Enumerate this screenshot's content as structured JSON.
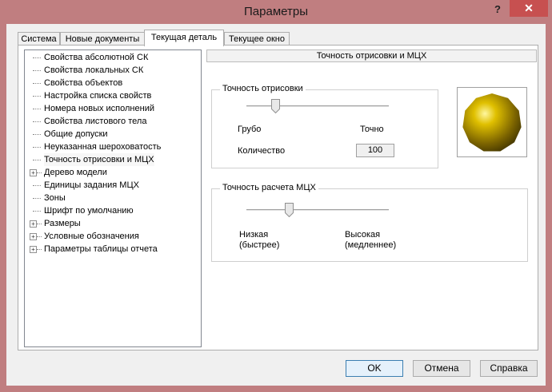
{
  "window": {
    "title": "Параметры",
    "help_label": "?",
    "close_label": "✕",
    "close_color": "#c75050"
  },
  "tabs": [
    {
      "label": "Система",
      "active": false
    },
    {
      "label": "Новые документы",
      "active": false
    },
    {
      "label": "Текущая деталь",
      "active": true
    },
    {
      "label": "Текущее окно",
      "active": false
    }
  ],
  "tree": {
    "items": [
      {
        "label": "Свойства абсолютной СК",
        "expandable": false,
        "selected": false
      },
      {
        "label": "Свойства локальных СК",
        "expandable": false,
        "selected": false
      },
      {
        "label": "Свойства объектов",
        "expandable": false,
        "selected": false
      },
      {
        "label": "Настройка списка свойств",
        "expandable": false,
        "selected": false
      },
      {
        "label": "Номера новых исполнений",
        "expandable": false,
        "selected": false
      },
      {
        "label": "Свойства листового тела",
        "expandable": false,
        "selected": false
      },
      {
        "label": "Общие допуски",
        "expandable": false,
        "selected": false
      },
      {
        "label": "Неуказанная шероховатость",
        "expandable": false,
        "selected": false
      },
      {
        "label": "Точность отрисовки и МЦХ",
        "expandable": false,
        "selected": true
      },
      {
        "label": "Дерево модели",
        "expandable": true,
        "selected": false
      },
      {
        "label": "Единицы задания МЦХ",
        "expandable": false,
        "selected": false
      },
      {
        "label": "Зоны",
        "expandable": false,
        "selected": false
      },
      {
        "label": "Шрифт по умолчанию",
        "expandable": false,
        "selected": false
      },
      {
        "label": "Размеры",
        "expandable": true,
        "selected": false
      },
      {
        "label": "Условные обозначения",
        "expandable": true,
        "selected": false
      },
      {
        "label": "Параметры таблицы отчета",
        "expandable": true,
        "selected": false
      }
    ],
    "expander_label": "+"
  },
  "pane": {
    "header": "Точность отрисовки и МЦХ",
    "drawing": {
      "title": "Точность отрисовки",
      "slider_level": 0.2,
      "min_label": "Грубо",
      "max_label": "Точно",
      "count_label": "Количество",
      "count_value": "100"
    },
    "mch": {
      "title": "Точность расчета МЦХ",
      "slider_level": 0.3,
      "min_label_line1": "Низкая",
      "min_label_line2": "(быстрее)",
      "max_label_line1": "Высокая",
      "max_label_line2": "(медленнее)"
    },
    "preview_color": "#c9a800"
  },
  "buttons": {
    "ok": "OK",
    "cancel": "Отмена",
    "help": "Справка"
  }
}
